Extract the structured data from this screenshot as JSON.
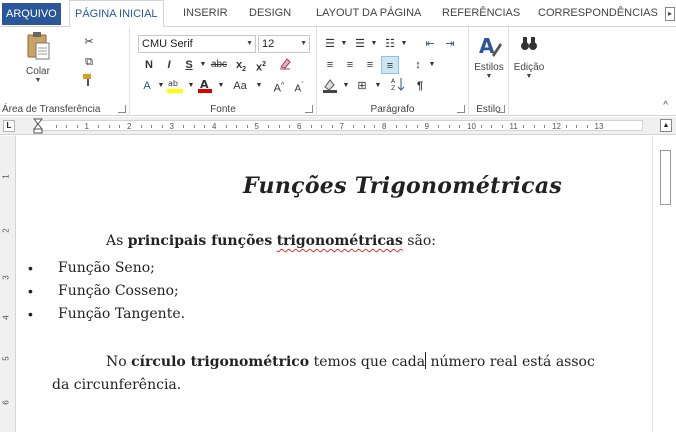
{
  "tabs": [
    {
      "label": "ARQUIVO",
      "kind": "file"
    },
    {
      "label": "PÁGINA INICIAL",
      "kind": "active"
    },
    {
      "label": "INSERIR",
      "kind": "normal"
    },
    {
      "label": "DESIGN",
      "kind": "normal"
    },
    {
      "label": "LAYOUT DA PÁGINA",
      "kind": "normal"
    },
    {
      "label": "REFERÊNCIAS",
      "kind": "normal"
    },
    {
      "label": "CORRESPONDÊNCIAS",
      "kind": "normal"
    }
  ],
  "ribbon": {
    "clipboard": {
      "label": "Área de Transferência",
      "paste": "Colar"
    },
    "font": {
      "label": "Fonte",
      "name": "CMU Serif",
      "size": "12",
      "case": "Aa"
    },
    "paragraph": {
      "label": "Parágrafo"
    },
    "styles": {
      "label": "Estilo",
      "button": "Estilos"
    },
    "editing": {
      "button": "Edição"
    }
  },
  "ruler": {
    "numbers": [
      "1",
      "2",
      "3",
      "4",
      "5",
      "6",
      "7",
      "8",
      "9",
      "10",
      "11",
      "12",
      "13"
    ]
  },
  "vruler": {
    "numbers": [
      "1",
      "2",
      "3",
      "4",
      "5",
      "6"
    ]
  },
  "document": {
    "title": "Funções Trigonométricas",
    "intro_pre": "As ",
    "intro_bold1": "principais funções",
    "intro_space": " ",
    "intro_bold2": "trigonométricas",
    "intro_post": " são:",
    "bullets": [
      "Função Seno;",
      "Função Cosseno;",
      "Função Tangente."
    ],
    "p2_pre": "No ",
    "p2_bold": "círculo trigonométrico",
    "p2_mid": " temos que cada",
    "p2_post": " número real está assoc",
    "p2_line2": "da circunferência."
  },
  "colors": {
    "accent": "#2b579a",
    "selection": "#cde6f7"
  }
}
